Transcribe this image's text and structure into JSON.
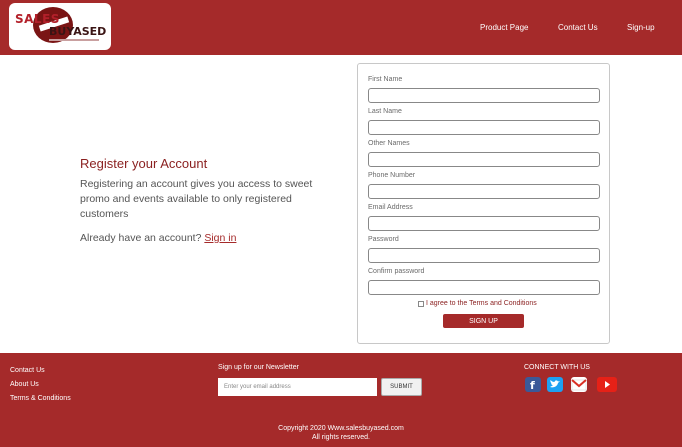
{
  "header": {
    "logo_text_top": "SALES",
    "logo_text_bottom": "BUYASED",
    "nav": [
      {
        "label": "Product Page"
      },
      {
        "label": "Contact Us"
      },
      {
        "label": "Sign-up"
      }
    ]
  },
  "register": {
    "title": "Register your Account",
    "description": "Registering an account gives you access to sweet promo and events available to only registered customers",
    "already_text": "Already have an account?",
    "signin_link": "Sign in"
  },
  "form": {
    "fields": [
      {
        "label": "First Name",
        "value": ""
      },
      {
        "label": "Last Name",
        "value": ""
      },
      {
        "label": "Other Names",
        "value": ""
      },
      {
        "label": "Phone Number",
        "value": ""
      },
      {
        "label": "Email Address",
        "value": ""
      },
      {
        "label": "Password",
        "value": ""
      },
      {
        "label": "Confirm password",
        "value": ""
      }
    ],
    "agree_label": "I agree to the Terms and Conditions",
    "submit_label": "SIGN UP"
  },
  "footer": {
    "links": [
      {
        "label": "Contact Us"
      },
      {
        "label": "About Us"
      },
      {
        "label": "Terms & Conditions"
      }
    ],
    "newsletter_title": "Sign up for our Newsletter",
    "newsletter_placeholder": "Enter your email address",
    "newsletter_button": "SUBMIT",
    "connect_title": "CONNECT WITH US",
    "social": [
      {
        "icon": "facebook-icon",
        "color": "#3b5998"
      },
      {
        "icon": "twitter-icon",
        "color": "#1da1f2"
      },
      {
        "icon": "gmail-icon",
        "color": "#ffffff"
      },
      {
        "icon": "youtube-icon",
        "color": "#e62117"
      }
    ],
    "copyright": "Copyright 2020 Www.salesbuyased.com",
    "rights": "All rights reserved."
  },
  "colors": {
    "brand": "#a52a2a",
    "text_muted": "#555555"
  }
}
